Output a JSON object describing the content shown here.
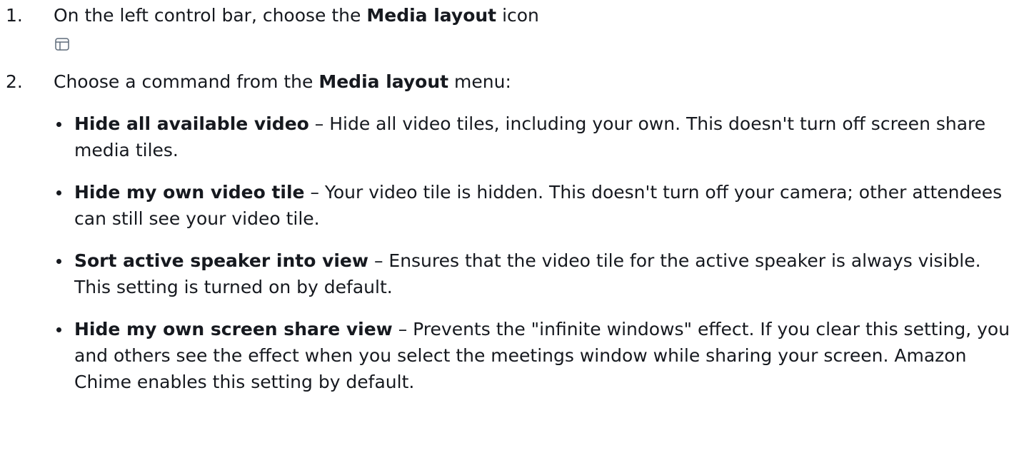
{
  "steps": [
    {
      "number": "1.",
      "text_before": "On the left control bar, choose the ",
      "bold": "Media layout",
      "text_after": " icon",
      "icon": "media-layout-icon"
    },
    {
      "number": "2.",
      "text_before": "Choose a command from the ",
      "bold": "Media layout",
      "text_after": " menu:"
    }
  ],
  "bullets": [
    {
      "bold": "Hide all available video",
      "text": " – Hide all video tiles, including your own. This doesn't turn off screen share media tiles."
    },
    {
      "bold": "Hide my own video tile",
      "text": " – Your video tile is hidden. This doesn't turn off your camera; other attendees can still see your video tile."
    },
    {
      "bold": "Sort active speaker into view",
      "text": " – Ensures that the video tile for the active speaker is always visible. This setting is turned on by default."
    },
    {
      "bold": "Hide my own screen share view",
      "text": " – Prevents the \"infinite windows\" effect. If you clear this setting, you and others see the effect when you select the meetings window while sharing your screen. Amazon Chime enables this setting by default."
    }
  ]
}
